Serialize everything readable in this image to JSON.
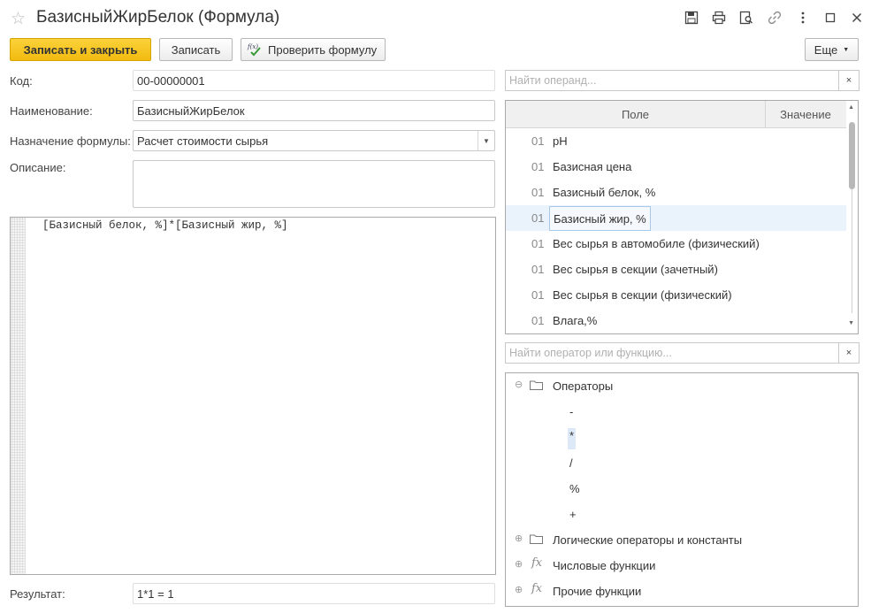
{
  "window": {
    "title": "БазисныйЖирБелок (Формула)",
    "icons": [
      "star-icon",
      "save-icon",
      "print-icon",
      "preview-icon",
      "link-icon",
      "more-vertical-icon",
      "maximize-icon",
      "close-icon"
    ]
  },
  "toolbar": {
    "save_close_label": "Записать и закрыть",
    "save_label": "Записать",
    "check_formula_label": "Проверить формулу",
    "more_label": "Еще"
  },
  "form": {
    "code_label": "Код:",
    "code_value": "00-00000001",
    "name_label": "Наименование:",
    "name_value": "БазисныйЖирБелок",
    "purpose_label": "Назначение формулы:",
    "purpose_value": "Расчет стоимости сырья",
    "description_label": "Описание:",
    "description_value": "",
    "formula_text": "[Базисный белок, %]*[Базисный жир, %]",
    "result_label": "Результат:",
    "result_value": "1*1 = 1"
  },
  "operands": {
    "search_placeholder": "Найти операнд...",
    "clear_label": "×",
    "col_field": "Поле",
    "col_value": "Значение",
    "rows": [
      {
        "code": "01",
        "name": "pH"
      },
      {
        "code": "01",
        "name": "Базисная цена"
      },
      {
        "code": "01",
        "name": "Базисный белок, %"
      },
      {
        "code": "01",
        "name": "Базисный жир, %"
      },
      {
        "code": "01",
        "name": "Вес сырья в автомобиле (физический)"
      },
      {
        "code": "01",
        "name": "Вес сырья в секции (зачетный)"
      },
      {
        "code": "01",
        "name": "Вес сырья в секции (физический)"
      },
      {
        "code": "01",
        "name": "Влага,%"
      }
    ],
    "selected_index": 3
  },
  "operators": {
    "search_placeholder": "Найти оператор или функцию...",
    "clear_label": "×",
    "groups": [
      {
        "label": "Операторы",
        "expanded": true,
        "icon": "folder-icon",
        "items": [
          "-",
          "*",
          "/",
          "%",
          "+"
        ]
      },
      {
        "label": "Логические операторы и константы",
        "expanded": false,
        "icon": "folder-icon"
      },
      {
        "label": "Числовые функции",
        "expanded": false,
        "icon": "function-icon"
      },
      {
        "label": "Прочие функции",
        "expanded": false,
        "icon": "function-icon"
      }
    ],
    "selected_item": "*"
  },
  "colors": {
    "primary_button": "#f2bb0f",
    "selection": "#eaf3fb"
  }
}
